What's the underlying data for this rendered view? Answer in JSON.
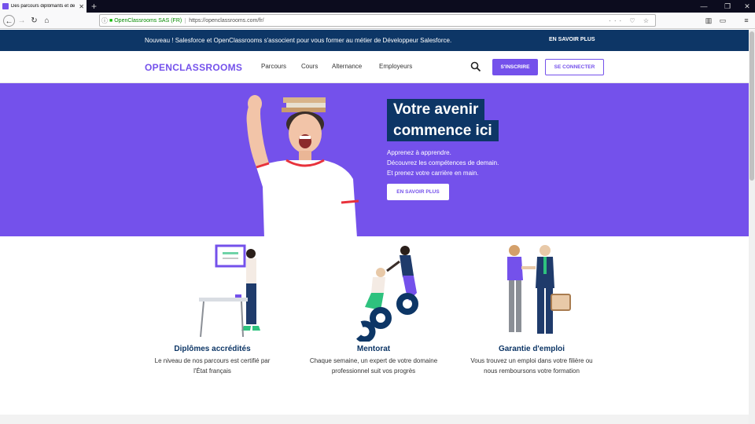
{
  "browser": {
    "tab_title": "Des parcours diplômants et de",
    "tab_close": "✕",
    "new_tab": "+",
    "cert_name": "OpenClassrooms SAS (FR)",
    "url": "https://openclassrooms.com/fr/",
    "url_actions": "··· ♡ ☆",
    "win_min": "—",
    "win_max": "❐",
    "win_close": "✕"
  },
  "banner": {
    "message": "Nouveau ! Salesforce et OpenClassrooms s'associent pour vous former au métier de Développeur Salesforce.",
    "cta": "EN SAVOIR PLUS"
  },
  "header": {
    "logo": "OPENCLASSROOMS",
    "nav": [
      "Parcours",
      "Cours",
      "Alternance",
      "Employeurs"
    ],
    "signup": "S'INSCRIRE",
    "login": "SE CONNECTER"
  },
  "hero": {
    "title_line1": "Votre avenir",
    "title_line2": "commence ici",
    "sub1": "Apprenez à apprendre.",
    "sub2": "Découvrez les compétences de demain.",
    "sub3": "Et prenez votre carrière en main.",
    "cta": "EN SAVOIR PLUS"
  },
  "features": [
    {
      "title": "Diplômes accrédités",
      "desc1": "Le niveau de nos parcours est certifié par",
      "desc2": "l'État français"
    },
    {
      "title": "Mentorat",
      "desc1": "Chaque semaine, un expert de votre domaine",
      "desc2": "professionnel suit vos progrès"
    },
    {
      "title": "Garantie d'emploi",
      "desc1": "Vous trouvez un emploi dans votre filière ou",
      "desc2": "nous remboursons votre formation"
    }
  ],
  "colors": {
    "brand": "#7451eb",
    "navy": "#0d3666"
  }
}
